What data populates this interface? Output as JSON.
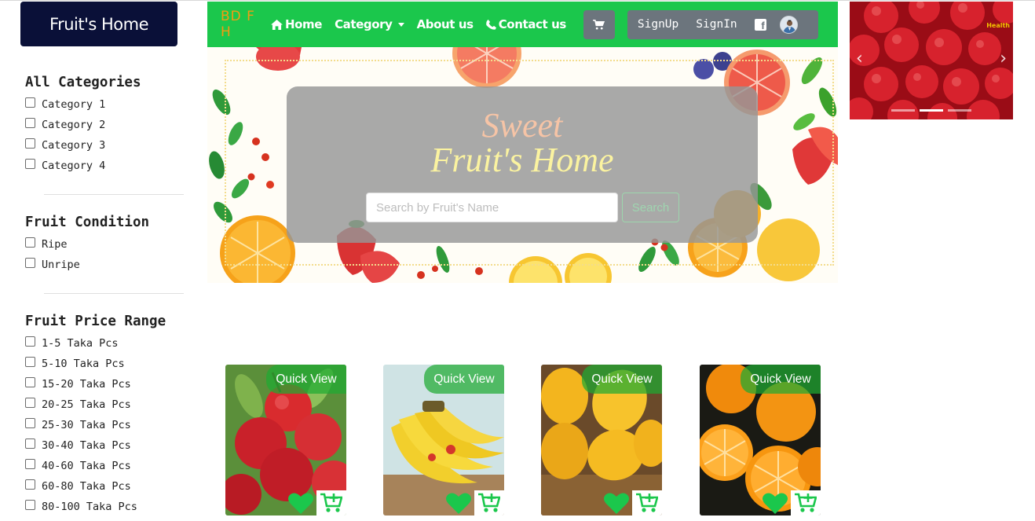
{
  "brand": {
    "title": "Fruit's Home"
  },
  "sidebar": {
    "groups": [
      {
        "title": "All Categories",
        "options": [
          "Category 1",
          "Category 2",
          "Category 3",
          "Category 4"
        ]
      },
      {
        "title": "Fruit Condition",
        "options": [
          "Ripe",
          "Unripe"
        ]
      },
      {
        "title": "Fruit Price Range",
        "options": [
          "1-5 Taka Pcs",
          "5-10 Taka Pcs",
          "15-20 Taka Pcs",
          "20-25 Taka Pcs",
          "25-30 Taka Pcs",
          "30-40 Taka Pcs",
          "40-60 Taka Pcs",
          "60-80 Taka Pcs",
          "80-100 Taka Pcs"
        ]
      }
    ]
  },
  "navbar": {
    "brand": "BD F H",
    "home": "Home",
    "category": "Category",
    "about": "About us",
    "contact": "Contact us",
    "signup": "SignUp",
    "signin": "SignIn"
  },
  "hero": {
    "sweet": "Sweet",
    "title": "Fruit's Home",
    "search_placeholder": "Search by Fruit's Name",
    "search_button": "Search"
  },
  "carousel": {
    "tag": "Health"
  },
  "products": [
    {
      "name": "apple",
      "quick_view": "Quick View"
    },
    {
      "name": "banana",
      "quick_view": "Quick View"
    },
    {
      "name": "mango",
      "quick_view": "Quick View"
    },
    {
      "name": "orange",
      "quick_view": "Quick View"
    }
  ],
  "colors": {
    "nav_green": "#1bc74c",
    "brand_navy": "#0a1038",
    "brand_orange": "#f39c12",
    "action_green": "#1bc74c"
  }
}
